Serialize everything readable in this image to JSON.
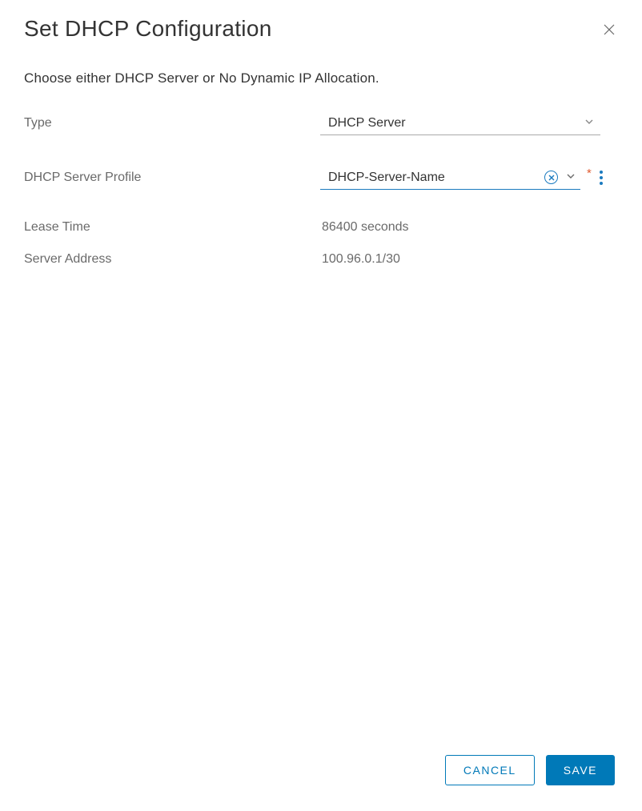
{
  "dialog": {
    "title": "Set DHCP Configuration",
    "description": "Choose either DHCP Server or No Dynamic IP Allocation."
  },
  "form": {
    "type_label": "Type",
    "type_value": "DHCP Server",
    "profile_label": "DHCP Server Profile",
    "profile_value": "DHCP-Server-Name",
    "required_mark": "*",
    "lease_label": "Lease Time",
    "lease_value": "86400 seconds",
    "address_label": "Server Address",
    "address_value": "100.96.0.1/30"
  },
  "footer": {
    "cancel": "CANCEL",
    "save": "SAVE"
  }
}
